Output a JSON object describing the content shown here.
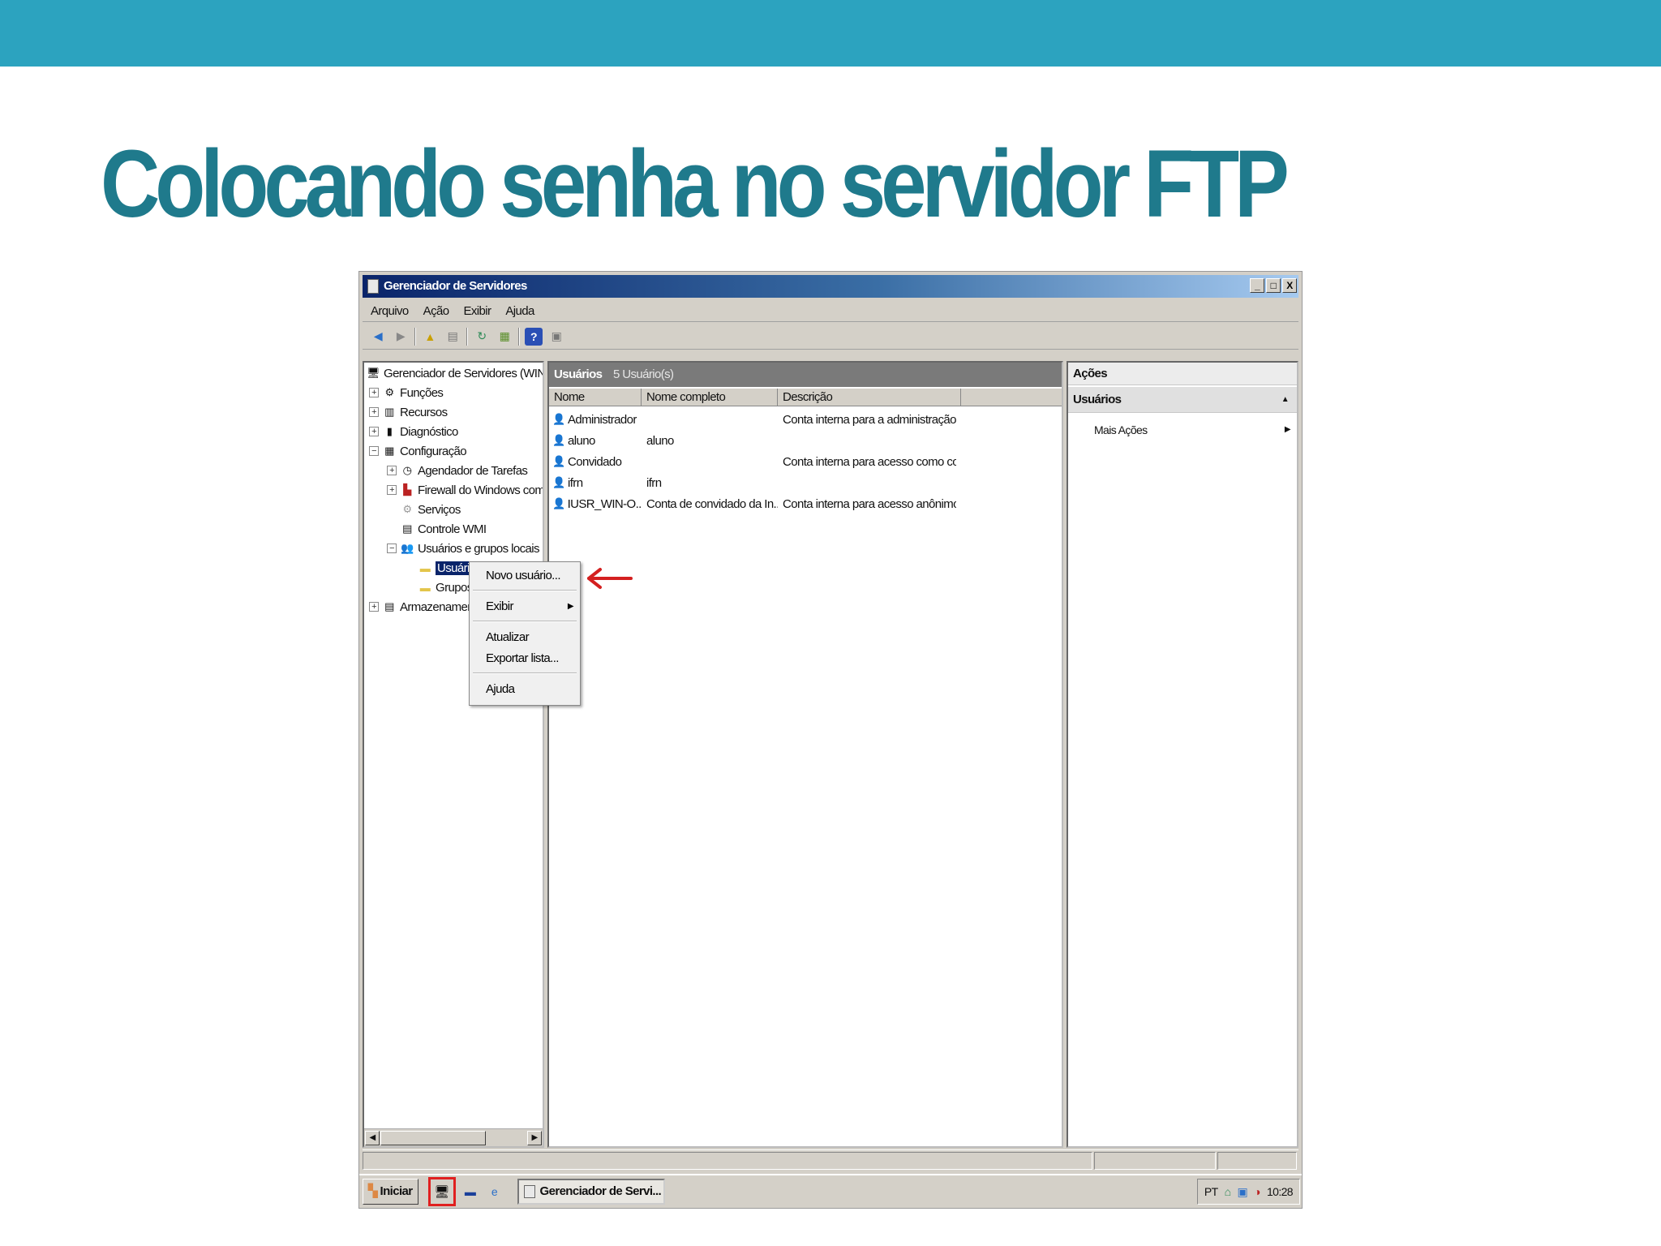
{
  "slide": {
    "title": "Colocando senha no servidor FTP"
  },
  "window": {
    "title": "Gerenciador de Servidores",
    "controls": [
      "_",
      "□",
      "X"
    ]
  },
  "menubar": {
    "items": [
      "Arquivo",
      "Ação",
      "Exibir",
      "Ajuda"
    ]
  },
  "tree": {
    "root": "Gerenciador de Servidores (WIN-OI",
    "items": [
      "Funções",
      "Recursos",
      "Diagnóstico",
      "Configuração",
      "Agendador de Tarefas",
      "Firewall do Windows com Se",
      "Serviços",
      "Controle WMI",
      "Usuários e grupos locais",
      "Usuári",
      "Grupos",
      "Armazenamen"
    ]
  },
  "list": {
    "title": "Usuários",
    "count": "5 Usuário(s)",
    "columns": [
      "Nome",
      "Nome completo",
      "Descrição"
    ],
    "rows": [
      {
        "name": "Administrador",
        "full": "",
        "desc": "Conta interna para a administração ..."
      },
      {
        "name": "aluno",
        "full": "aluno",
        "desc": ""
      },
      {
        "name": "Convidado",
        "full": "",
        "desc": "Conta interna para acesso como con..."
      },
      {
        "name": "ifrn",
        "full": "ifrn",
        "desc": ""
      },
      {
        "name": "IUSR_WIN-O...",
        "full": "Conta de convidado da In...",
        "desc": "Conta interna para acesso anônimo ..."
      }
    ]
  },
  "actions": {
    "title": "Ações",
    "section": "Usuários",
    "item": "Mais Ações"
  },
  "context_menu": {
    "items": [
      "Novo usuário...",
      "Exibir",
      "Atualizar",
      "Exportar lista...",
      "Ajuda"
    ]
  },
  "taskbar": {
    "start": "Iniciar",
    "task": "Gerenciador de Servi...",
    "lang": "PT",
    "clock": "10:28"
  },
  "colors": {
    "topbar": "#2ca3bf",
    "title": "#1f7a8c",
    "highlight": "#e02020"
  }
}
